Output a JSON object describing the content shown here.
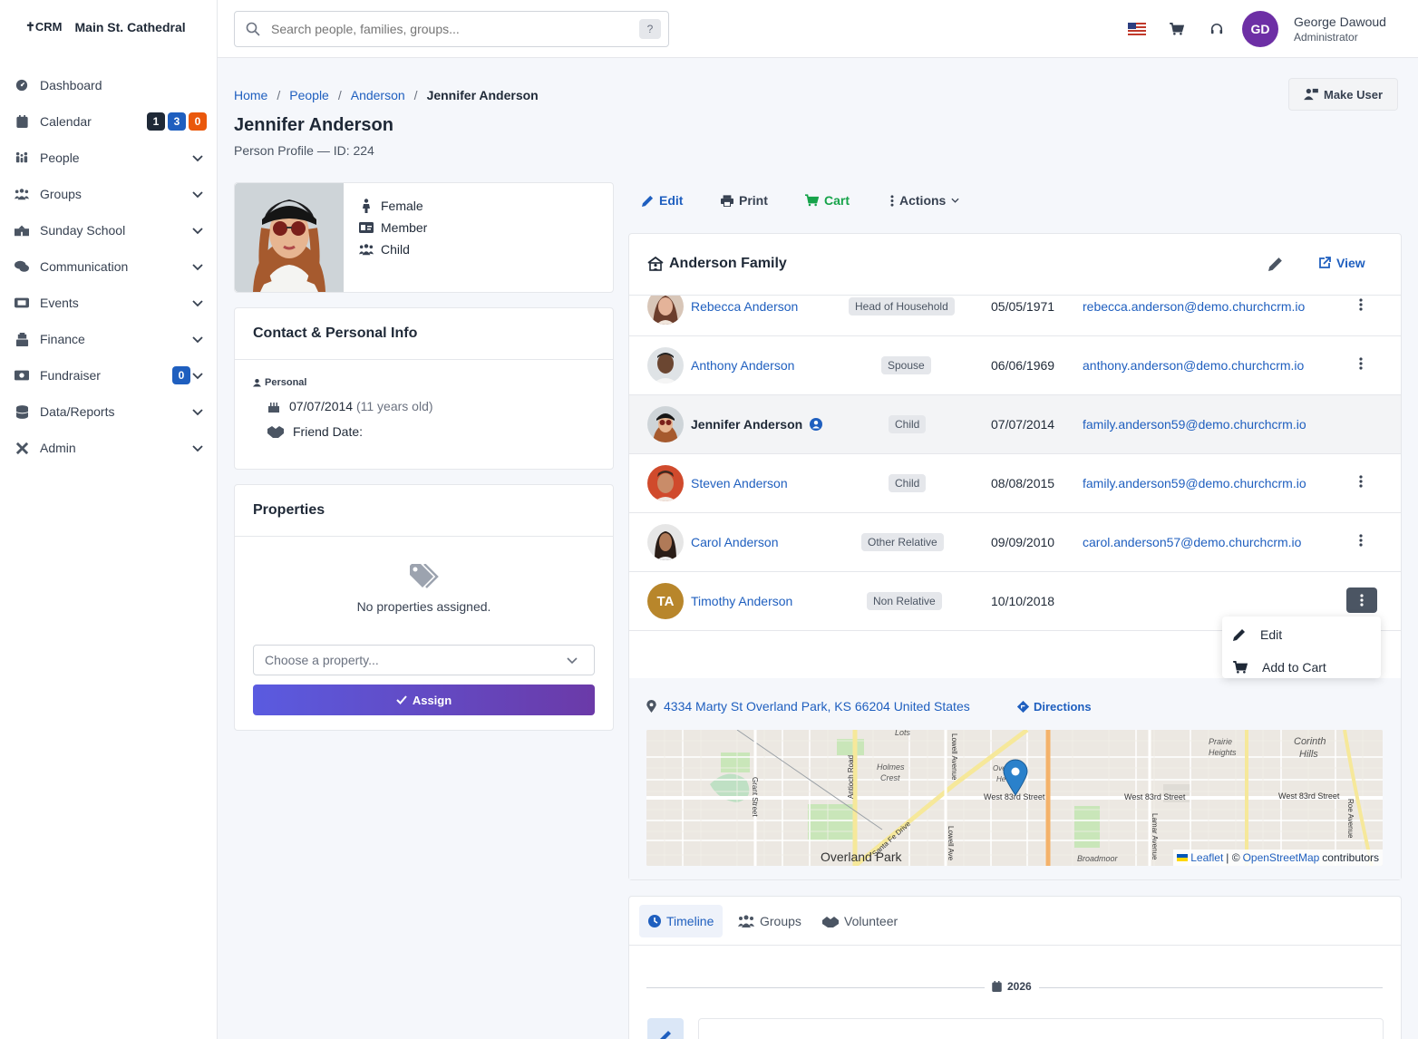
{
  "brand": {
    "logo": "CRM",
    "name": "Main St. Cathedral"
  },
  "sidebar": {
    "items": [
      {
        "label": "Dashboard",
        "icon": "gauge-icon"
      },
      {
        "label": "Calendar",
        "icon": "calendar-icon",
        "badges": [
          "1",
          "3",
          "0"
        ]
      },
      {
        "label": "People",
        "icon": "people-icon"
      },
      {
        "label": "Groups",
        "icon": "groups-icon"
      },
      {
        "label": "Sunday School",
        "icon": "school-icon"
      },
      {
        "label": "Communication",
        "icon": "comments-icon"
      },
      {
        "label": "Events",
        "icon": "ticket-icon"
      },
      {
        "label": "Finance",
        "icon": "cash-register-icon"
      },
      {
        "label": "Fundraiser",
        "icon": "money-bill-icon",
        "badges": [
          "0"
        ]
      },
      {
        "label": "Data/Reports",
        "icon": "database-icon"
      },
      {
        "label": "Admin",
        "icon": "tools-icon"
      }
    ],
    "badge_colors": {
      "dark": "#1f2937",
      "blue": "#1f5fbf",
      "orange": "#ea580c"
    }
  },
  "header": {
    "search_placeholder": "Search people, families, groups...",
    "search_shortcut": "?",
    "user_initials": "GD",
    "user_name": "George Dawoud",
    "user_role": "Administrator"
  },
  "breadcrumb": [
    "Home",
    "People",
    "Anderson",
    "Jennifer Anderson"
  ],
  "page": {
    "title": "Jennifer Anderson",
    "subtitle": "Person Profile — ID: 224",
    "make_user": "Make User"
  },
  "person": {
    "gender": "Female",
    "classification": "Member",
    "family_role": "Child"
  },
  "contact": {
    "title": "Contact & Personal Info",
    "section": "Personal",
    "birthdate": "07/07/2014",
    "age": "(11 years old)",
    "friend_date_label": "Friend Date:"
  },
  "properties": {
    "title": "Properties",
    "empty": "No properties assigned.",
    "select_placeholder": "Choose a property...",
    "assign": "Assign"
  },
  "toolbar": {
    "edit": "Edit",
    "print": "Print",
    "cart": "Cart",
    "actions": "Actions"
  },
  "family": {
    "title": "Anderson Family",
    "view": "View",
    "members": [
      {
        "name": "Rebecca Anderson",
        "role": "Head of Household",
        "date": "05/05/1971",
        "email": "rebecca.anderson@demo.churchcrm.io"
      },
      {
        "name": "Anthony Anderson",
        "role": "Spouse",
        "date": "06/06/1969",
        "email": "anthony.anderson@demo.churchcrm.io"
      },
      {
        "name": "Jennifer Anderson",
        "role": "Child",
        "date": "07/07/2014",
        "email": "family.anderson59@demo.churchcrm.io"
      },
      {
        "name": "Steven Anderson",
        "role": "Child",
        "date": "08/08/2015",
        "email": "family.anderson59@demo.churchcrm.io"
      },
      {
        "name": "Carol Anderson",
        "role": "Other Relative",
        "date": "09/09/2010",
        "email": "carol.anderson57@demo.churchcrm.io"
      },
      {
        "name": "Timothy Anderson",
        "role": "Non Relative",
        "date": "10/10/2018",
        "email": "",
        "initials": "TA"
      }
    ],
    "dropdown": {
      "edit": "Edit",
      "add_to_cart": "Add to Cart"
    },
    "address": "4334 Marty St Overland Park, KS 66204 United States",
    "directions": "Directions"
  },
  "map": {
    "labels": {
      "city": "Overland Park",
      "street1": "West 83rd Street",
      "street2": "West 83rd Street",
      "street3": "West 83rd Street",
      "holmes": "Holmes",
      "crest": "Crest",
      "prairie": "Prairie",
      "heights": "Heights",
      "corinth": "Corinth",
      "hills": "Hills",
      "broadmoor": "Broadmoor",
      "lots": "Lots",
      "santa_fe": "Santa Fe Drive",
      "antioch": "Antioch Road",
      "lowell": "Lowell Avenue",
      "lowell2": "Lowell Ave",
      "grant": "Grant Street",
      "lamar": "Lamar Avenue",
      "roe": "Roe Avenue",
      "overland_partial": "Overl",
      "heights_partial": "He"
    },
    "attribution": {
      "leaflet": "Leaflet",
      "sep": "| ©",
      "osm": "OpenStreetMap",
      "contrib": "contributors"
    }
  },
  "tabs": {
    "timeline": "Timeline",
    "groups": "Groups",
    "volunteer": "Volunteer"
  },
  "timeline": {
    "year": "2026"
  }
}
